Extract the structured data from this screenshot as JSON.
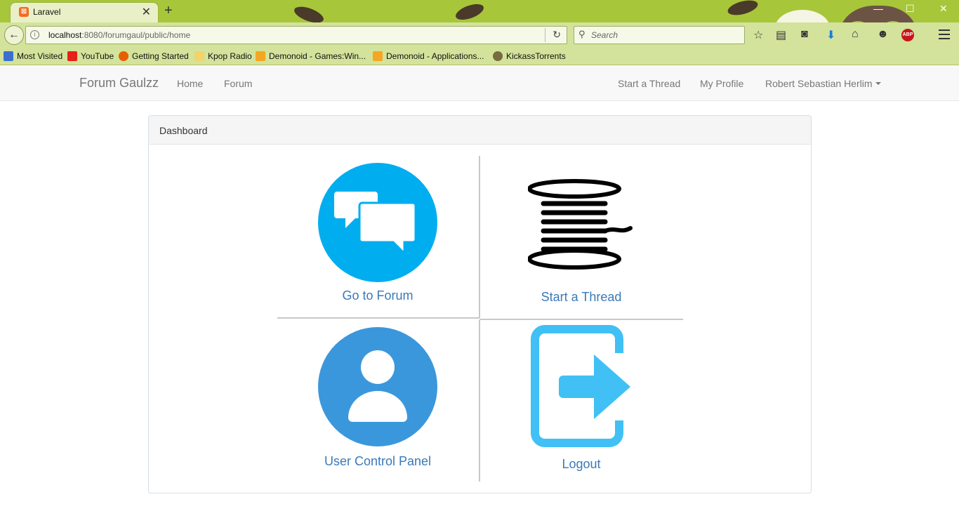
{
  "browser": {
    "tab_title": "Laravel",
    "tab_close": "✕",
    "new_tab": "+",
    "url_host": "localhost",
    "url_rest": ":8080/forumgaul/public/home",
    "search_placeholder": "Search",
    "bookmarks": [
      {
        "label": "Most Visited",
        "icon": "most-visited-icon",
        "color": "#3b6fcf"
      },
      {
        "label": "YouTube",
        "icon": "youtube-icon",
        "color": "#e62117"
      },
      {
        "label": "Getting Started",
        "icon": "firefox-icon",
        "color": "#e66000"
      },
      {
        "label": "Kpop Radio",
        "icon": "folder-icon",
        "color": "#f3c84b"
      },
      {
        "label": "Demonoid - Games:Win...",
        "icon": "rss-icon",
        "color": "#f5a623"
      },
      {
        "label": "Demonoid - Applications...",
        "icon": "rss-icon",
        "color": "#f5a623"
      },
      {
        "label": "KickassTorrents",
        "icon": "kickass-icon",
        "color": "#7a6a42"
      }
    ]
  },
  "site": {
    "brand": "Forum Gaulzz",
    "nav_left": [
      "Home",
      "Forum"
    ],
    "nav_right": [
      "Start a Thread",
      "My Profile",
      "Robert Sebastian Herlim"
    ]
  },
  "panel": {
    "heading": "Dashboard",
    "tiles": [
      {
        "label": "Go to Forum",
        "icon": "chat-bubbles-icon"
      },
      {
        "label": "Start a Thread",
        "icon": "thread-spool-icon"
      },
      {
        "label": "User Control Panel",
        "icon": "user-icon"
      },
      {
        "label": "Logout",
        "icon": "logout-icon"
      }
    ]
  },
  "colors": {
    "chrome_green": "#a8c63a",
    "link_blue": "#3a79b8",
    "forum_icon_blue": "#00aeef",
    "user_icon_blue": "#3a97dc",
    "logout_icon_blue": "#40c0f5"
  }
}
